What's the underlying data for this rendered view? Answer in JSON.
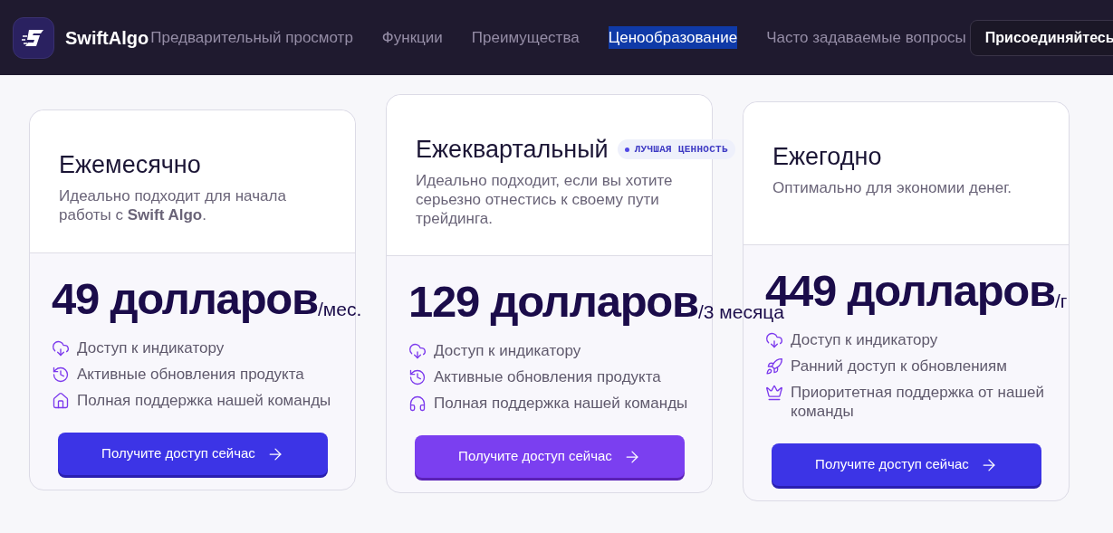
{
  "header": {
    "brand": "SwiftAlgo",
    "nav": [
      {
        "label": "Предварительный просмотр",
        "selected": false
      },
      {
        "label": "Функции",
        "selected": false
      },
      {
        "label": "Преимущества",
        "selected": false
      },
      {
        "label": "Ценообразование",
        "selected": true
      },
      {
        "label": "Часто задаваемые вопросы",
        "selected": false
      }
    ],
    "join_button": "Присоединяйтесь"
  },
  "plans": [
    {
      "title": "Ежемесячно",
      "description": "Идеально подходит для начала работы с **Swift Algo**.",
      "price": "49 долларов",
      "period": "/мес.",
      "featured": false,
      "features": [
        {
          "kind": "cloud",
          "text": "Доступ к индикатору"
        },
        {
          "kind": "refresh",
          "text": "Активные обновления продукта"
        },
        {
          "kind": "home",
          "text": "Полная поддержка нашей команды"
        }
      ],
      "button": "Получите доступ сейчас"
    },
    {
      "title": "Ежеквартальный",
      "badge": "ЛУЧШАЯ ЦЕННОСТЬ",
      "description": "Идеально подходит, если вы хотите серьезно отнестись к своему пути трейдинга.",
      "price": "129 долларов",
      "period": "/3 месяца",
      "featured": true,
      "features": [
        {
          "kind": "cloud",
          "text": "Доступ к индикатору"
        },
        {
          "kind": "refresh",
          "text": "Активные обновления продукта"
        },
        {
          "kind": "headphones",
          "text": "Полная поддержка нашей команды"
        }
      ],
      "button": "Получите доступ сейчас"
    },
    {
      "title": "Ежегодно",
      "description": "Оптимально для экономии денег.",
      "price": "449 долларов",
      "period": "/г",
      "featured": false,
      "features": [
        {
          "kind": "cloud",
          "text": "Доступ к индикатору"
        },
        {
          "kind": "rocket",
          "text": "Ранний доступ к обновлениям"
        },
        {
          "kind": "crown",
          "text": "Приоритетная поддержка от нашей команды"
        }
      ],
      "button": "Получите доступ сейчас"
    }
  ]
}
